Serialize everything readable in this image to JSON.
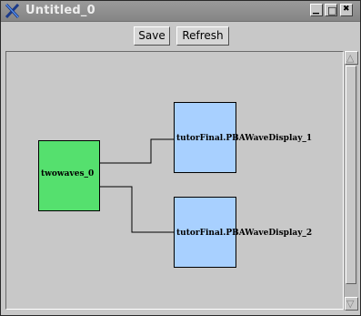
{
  "window": {
    "title": "Untitled_0",
    "minimize_glyph": "▁",
    "maximize_glyph": "□",
    "close_glyph": "✖"
  },
  "toolbar": {
    "save_label": "Save",
    "refresh_label": "Refresh"
  },
  "graph": {
    "nodes": [
      {
        "id": "twowaves_0",
        "label": "twowaves_0",
        "color": "#55e06e"
      },
      {
        "id": "display_1",
        "label": "tutorFinal.PBAWaveDisplay_1",
        "color": "#a8d0ff"
      },
      {
        "id": "display_2",
        "label": "tutorFinal.PBAWaveDisplay_2",
        "color": "#a8d0ff"
      }
    ],
    "edges": [
      {
        "from": "display_1",
        "to": "twowaves_0"
      },
      {
        "from": "display_2",
        "to": "twowaves_0"
      }
    ]
  },
  "scrollbar": {
    "up_glyph": "△",
    "down_glyph": "▽"
  }
}
